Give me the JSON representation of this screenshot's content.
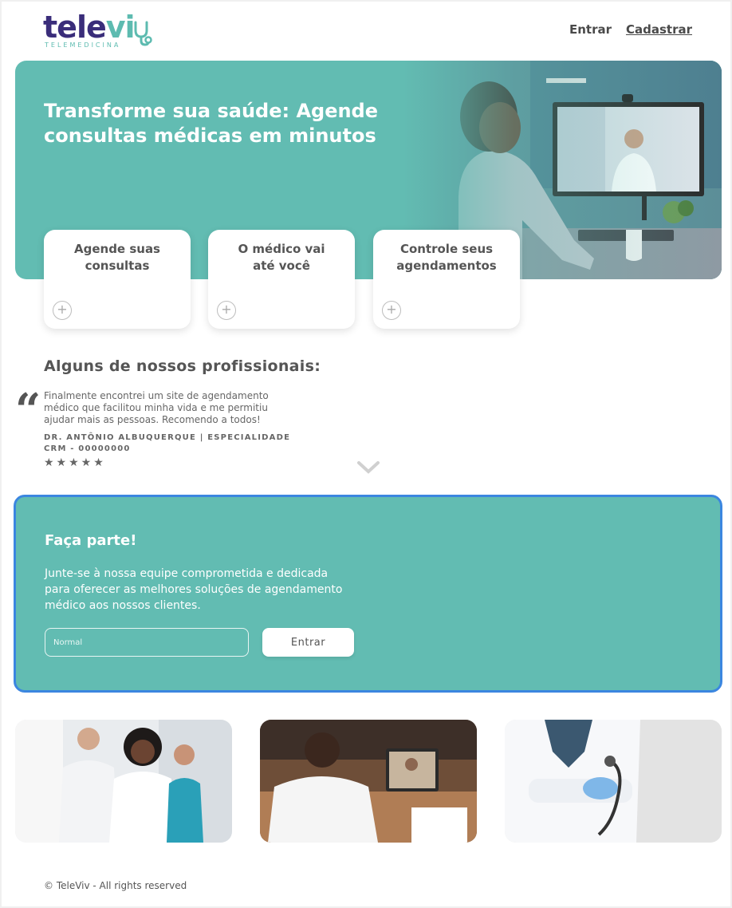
{
  "brand": {
    "name_part1": "tele",
    "name_part2": "vi",
    "subtitle": "TELEMEDICINA"
  },
  "nav": {
    "login": "Entrar",
    "signup": "Cadastrar"
  },
  "hero": {
    "title": "Transforme sua saúde: Agende consultas médicas em minutos",
    "cards": [
      {
        "label": "Agende suas\nconsultas"
      },
      {
        "label": "O médico vai\naté você"
      },
      {
        "label": "Controle seus\nagendamentos"
      }
    ]
  },
  "professionals": {
    "title": "Alguns de nossos profissionais:",
    "testimonial": "Finalmente encontrei um site de agendamento médico que facilitou minha vida e me permitiu ajudar mais as pessoas. Recomendo a todos!",
    "author_line1": "DR. ANTÔNIO ALBUQUERQUE | ESPECIALIDADE",
    "author_line2": "CRM - 00000000",
    "rating": 5,
    "stars": "★★★★★"
  },
  "join": {
    "title": "Faça parte!",
    "text": "Junte-se à nossa equipe comprometida e dedicada para oferecer as melhores soluções de agendamento médico aos nossos clientes.",
    "input_placeholder": "Normal",
    "button": "Entrar"
  },
  "footer": {
    "copyright": "© TeleViv - All rights reserved"
  },
  "colors": {
    "teal": "#62bcb2",
    "purple": "#3a2d7a",
    "focus_border": "#3b86e0"
  }
}
